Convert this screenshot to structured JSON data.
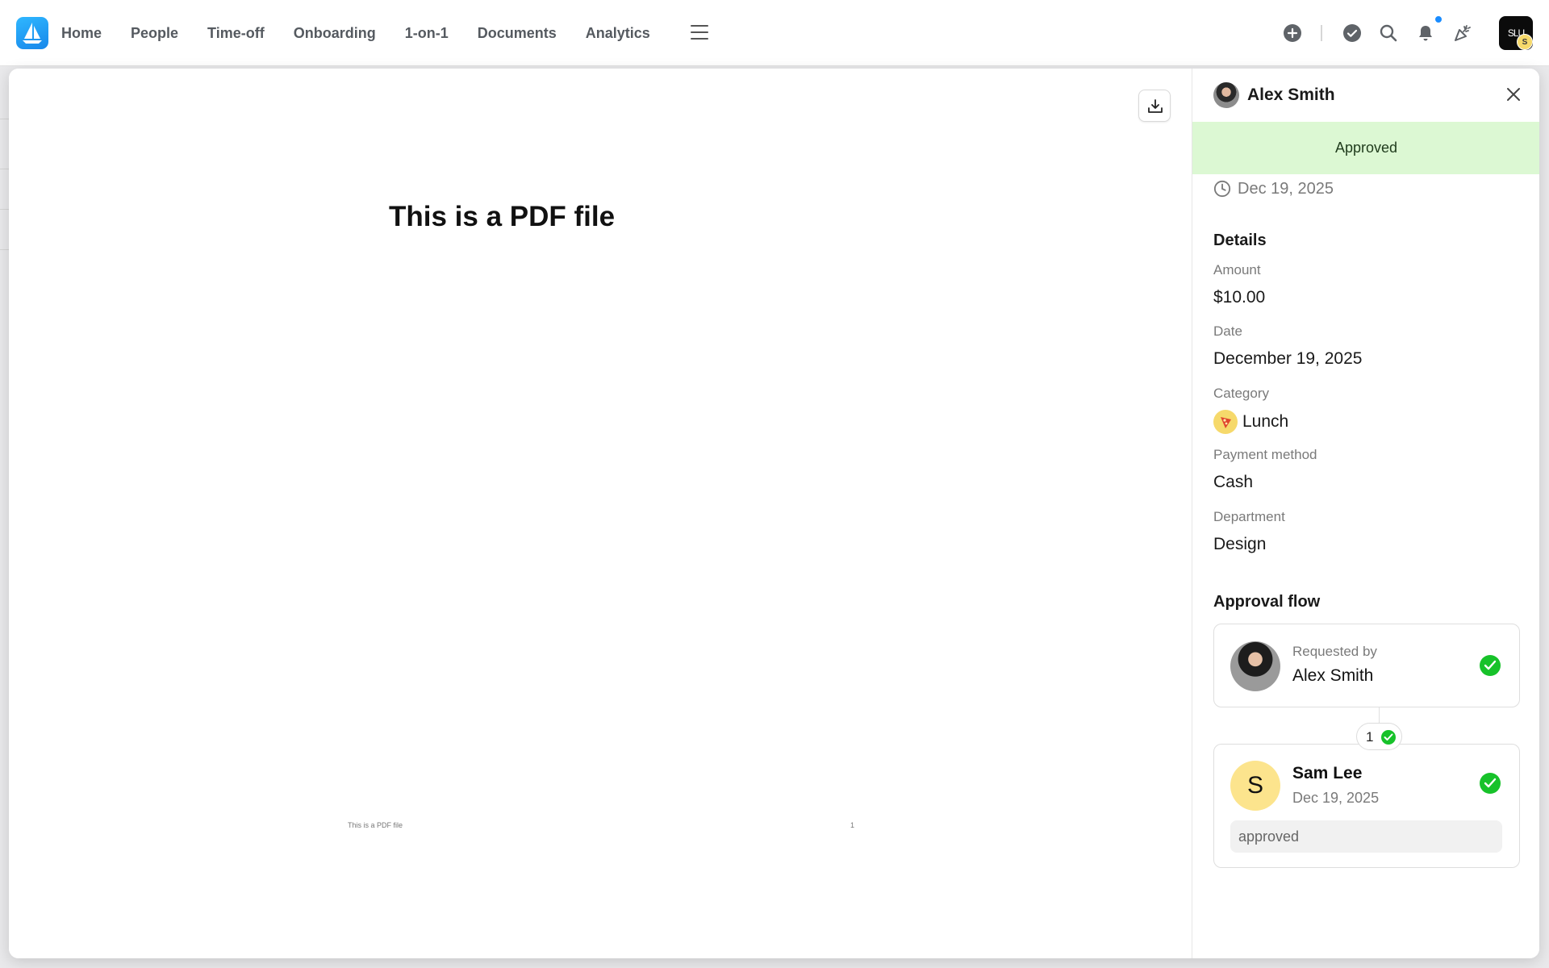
{
  "nav": {
    "items": [
      "Home",
      "People",
      "Time-off",
      "Onboarding",
      "1-on-1",
      "Documents",
      "Analytics"
    ]
  },
  "topbar": {
    "user_initials": "SLU",
    "user_badge": "S",
    "icons": [
      "plus-circle-icon",
      "check-circle-icon",
      "search-icon",
      "bell-icon",
      "party-popper-icon"
    ],
    "notification_dot_color": "#1a8cff"
  },
  "viewer": {
    "pdf_title": "This is a PDF file",
    "pdf_footer_left": "This is a PDF file",
    "pdf_footer_right": "1"
  },
  "panel": {
    "requester_name": "Alex Smith",
    "status": "Approved",
    "status_color": "#dcf8d3",
    "submitted_date": "Dec 19, 2025",
    "details_title": "Details",
    "fields": {
      "amount_label": "Amount",
      "amount_value": "$10.00",
      "date_label": "Date",
      "date_value": "December 19, 2025",
      "category_label": "Category",
      "category_value": "Lunch",
      "payment_label": "Payment method",
      "payment_value": "Cash",
      "department_label": "Department",
      "department_value": "Design"
    },
    "approval_flow": {
      "title": "Approval flow",
      "requested_by_label": "Requested by",
      "requested_by_name": "Alex Smith",
      "step_number": "1",
      "approver_initial": "S",
      "approver_name": "Sam Lee",
      "approver_date": "Dec 19, 2025",
      "approver_comment": "approved",
      "check_color": "#17c22a"
    }
  }
}
